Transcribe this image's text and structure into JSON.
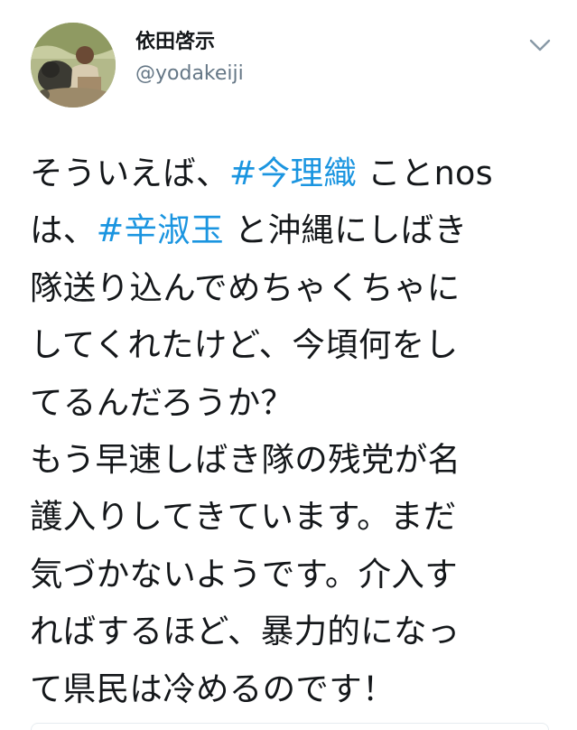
{
  "author": {
    "display_name": "依田啓示",
    "handle": "@yodakeiji",
    "avatar_icon": "profile-photo"
  },
  "menu_icon": "chevron-down-icon",
  "tweet": {
    "lines": [
      [
        {
          "text": "そういえば、",
          "type": "text"
        },
        {
          "text": "#今理織",
          "type": "hashtag"
        },
        {
          "text": " ことnos",
          "type": "text"
        }
      ],
      [
        {
          "text": "は、",
          "type": "text"
        },
        {
          "text": "#辛淑玉",
          "type": "hashtag"
        },
        {
          "text": " と沖縄にしばき",
          "type": "text"
        }
      ],
      [
        {
          "text": "隊送り込んでめちゃくちゃに",
          "type": "text"
        }
      ],
      [
        {
          "text": "してくれたけど、今頃何をし",
          "type": "text"
        }
      ],
      [
        {
          "text": "てるんだろうか？",
          "type": "text"
        }
      ],
      [
        {
          "text": "もう早速しばき隊の残党が名",
          "type": "text"
        }
      ],
      [
        {
          "text": "護入りしてきています。まだ",
          "type": "text"
        }
      ],
      [
        {
          "text": "気づかないようです。介入す",
          "type": "text"
        }
      ],
      [
        {
          "text": "ればするほど、暴力的になっ",
          "type": "text"
        }
      ],
      [
        {
          "text": "て県民は冷めるのです！",
          "type": "text"
        }
      ]
    ]
  },
  "colors": {
    "hashtag": "#1b95e0",
    "handle": "#657786",
    "text": "#14171a",
    "divider": "#e6ecf0"
  }
}
